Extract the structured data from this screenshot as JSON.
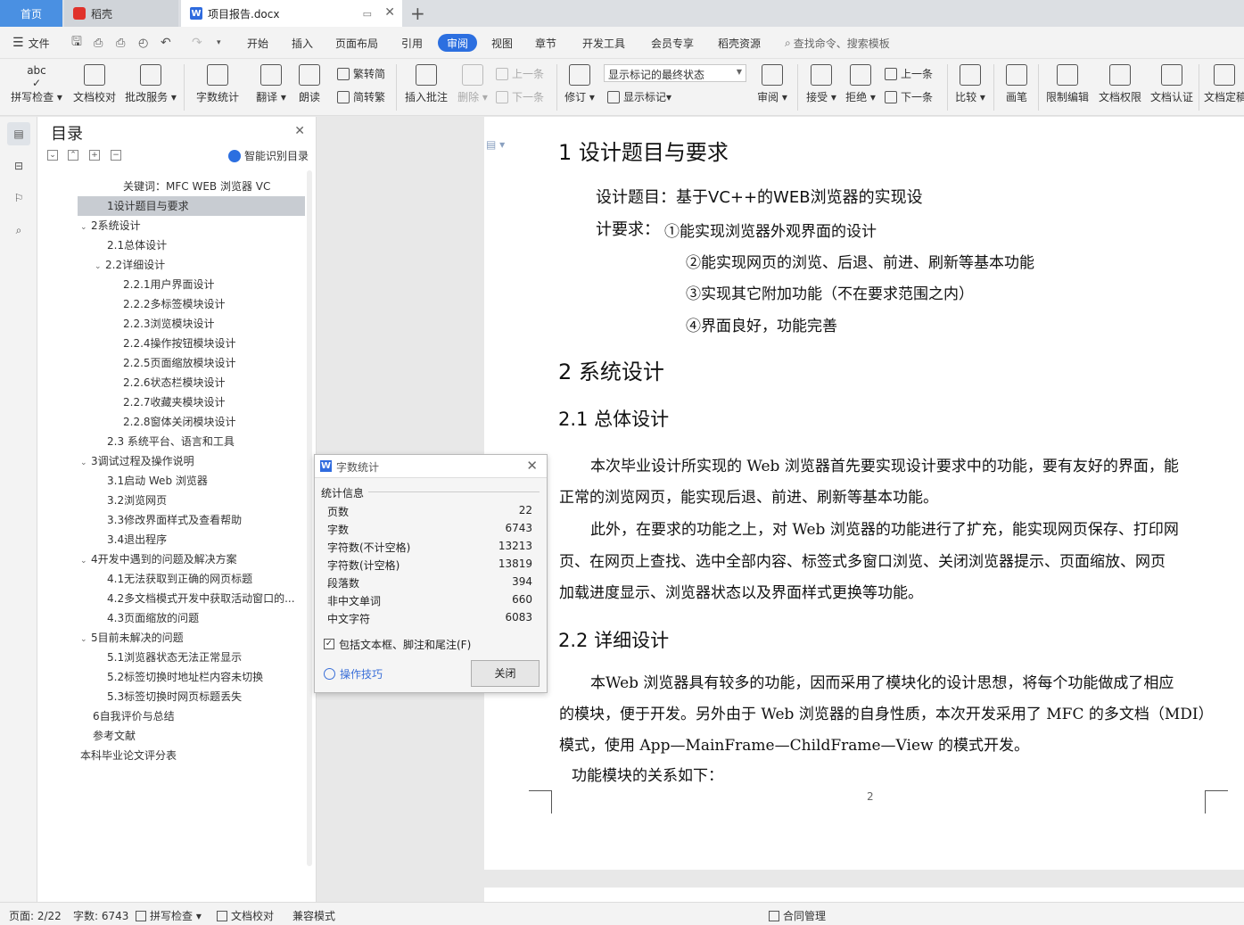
{
  "tabs": {
    "home": "首页",
    "daoke": "稻壳",
    "doc": "项目报告.docx",
    "add": "+"
  },
  "menu": {
    "file": "文件",
    "items": [
      "开始",
      "插入",
      "页面布局",
      "引用",
      "审阅",
      "视图",
      "章节",
      "开发工具",
      "会员专享",
      "稻壳资源"
    ],
    "search": "查找命令、搜索模板"
  },
  "ribbon": {
    "spell": "拼写检查",
    "proof": "文档校对",
    "batch": "批改服务",
    "count": "字数统计",
    "translate": "翻译",
    "read": "朗读",
    "trad": "繁转简",
    "simp": "简转繁",
    "insert_comment": "插入批注",
    "delete": "删除",
    "prev_comment": "上一条",
    "next_comment": "下一条",
    "revise": "修订",
    "markup_select": "显示标记的最终状态",
    "show_markup": "显示标记",
    "review": "审阅",
    "accept": "接受",
    "reject": "拒绝",
    "prev_change": "上一条",
    "next_change": "下一条",
    "compare": "比较",
    "pen": "画笔",
    "restrict": "限制编辑",
    "perm": "文档权限",
    "auth": "文档认证",
    "final": "文档定稿"
  },
  "toc": {
    "title": "目录",
    "smart": "智能识别目录",
    "items": [
      {
        "label": "关键词：MFC WEB 浏览器 VC",
        "level": "kw"
      },
      {
        "label": "1设计题目与要求",
        "level": 2
      },
      {
        "label": "2系统设计",
        "level": 1,
        "chev": "v"
      },
      {
        "label": "2.1总体设计",
        "level": 2
      },
      {
        "label": "2.2详细设计",
        "level": 2,
        "chev": "v"
      },
      {
        "label": "2.2.1用户界面设计",
        "level": 3
      },
      {
        "label": "2.2.2多标签模块设计",
        "level": 3
      },
      {
        "label": "2.2.3浏览模块设计",
        "level": 3
      },
      {
        "label": "2.2.4操作按钮模块设计",
        "level": 3
      },
      {
        "label": "2.2.5页面缩放模块设计",
        "level": 3
      },
      {
        "label": "2.2.6状态栏模块设计",
        "level": 3
      },
      {
        "label": "2.2.7收藏夹模块设计",
        "level": 3
      },
      {
        "label": "2.2.8窗体关闭模块设计",
        "level": 3
      },
      {
        "label": "2.3 系统平台、语言和工具",
        "level": 2
      },
      {
        "label": "3调试过程及操作说明",
        "level": 1,
        "chev": "v"
      },
      {
        "label": "3.1启动 Web 浏览器",
        "level": 2
      },
      {
        "label": "3.2浏览网页",
        "level": 2
      },
      {
        "label": "3.3修改界面样式及查看帮助",
        "level": 2
      },
      {
        "label": "3.4退出程序",
        "level": 2
      },
      {
        "label": "4开发中遇到的问题及解决方案",
        "level": 1,
        "chev": "v"
      },
      {
        "label": "4.1无法获取到正确的网页标题",
        "level": 2
      },
      {
        "label": "4.2多文档模式开发中获取活动窗口的...",
        "level": 2
      },
      {
        "label": "4.3页面缩放的问题",
        "level": 2
      },
      {
        "label": "5目前未解决的问题",
        "level": 1,
        "chev": "v"
      },
      {
        "label": "5.1浏览器状态无法正常显示",
        "level": 2
      },
      {
        "label": "5.2标签切换时地址栏内容未切换",
        "level": 2
      },
      {
        "label": "5.3标签切换时网页标题丢失",
        "level": 2
      },
      {
        "label": "6自我评价与总结",
        "level": 1
      },
      {
        "label": "参考文献",
        "level": 1
      },
      {
        "label": "本科毕业论文评分表",
        "level": 0
      }
    ]
  },
  "doc": {
    "h1a": "1  设计题目与要求",
    "req1": "设计题目：基于VC++的WEB浏览器的实现设",
    "req2a": "计要求：",
    "req2b": "①能实现浏览器外观界面的设计",
    "req3": "②能实现网页的浏览、后退、前进、刷新等基本功能",
    "req4": "③实现其它附加功能（不在要求范围之内）",
    "req5": "④界面良好，功能完善",
    "h1b": "2  系统设计",
    "h21": "2.1  总体设计",
    "p1a": "本次毕业设计所实现的 Web 浏览器首先要实现设计要求中的功能，要有友好的界面，能",
    "p1b": "正常的浏览网页，能实现后退、前进、刷新等基本功能。",
    "p2a": "此外，在要求的功能之上，对 Web 浏览器的功能进行了扩充，能实现网页保存、打印网",
    "p2b": "页、在网页上查找、选中全部内容、标签式多窗口浏览、关闭浏览器提示、页面缩放、网页",
    "p2c": "加载进度显示、浏览器状态以及界面样式更换等功能。",
    "h22": "2.2  详细设计",
    "p3a": "本Web 浏览器具有较多的功能，因而采用了模块化的设计思想，将每个功能做成了相应",
    "p3b": "的模块，便于开发。另外由于 Web 浏览器的自身性质，本次开发采用了 MFC 的多文档（MDI）",
    "p3c": "模式，使用 App—MainFrame—ChildFrame—View 的模式开发。",
    "p4": "功能模块的关系如下：",
    "pagenum": "2"
  },
  "wordcount": {
    "title": "字数统计",
    "section": "统计信息",
    "rows": [
      {
        "k": "页数",
        "v": "22"
      },
      {
        "k": "字数",
        "v": "6743"
      },
      {
        "k": "字符数(不计空格)",
        "v": "13213"
      },
      {
        "k": "字符数(计空格)",
        "v": "13819"
      },
      {
        "k": "段落数",
        "v": "394"
      },
      {
        "k": "非中文单词",
        "v": "660"
      },
      {
        "k": "中文字符",
        "v": "6083"
      }
    ],
    "include": "包括文本框、脚注和尾注(F)",
    "tips": "操作技巧",
    "close": "关闭"
  },
  "status": {
    "page": "页面: 2/22",
    "words": "字数: 6743",
    "spell": "拼写检查",
    "proof": "文档校对",
    "compat": "兼容模式",
    "contract": "合同管理"
  },
  "colors": {
    "accent": "#2c6fe0",
    "home_tab": "#4a90e2"
  }
}
